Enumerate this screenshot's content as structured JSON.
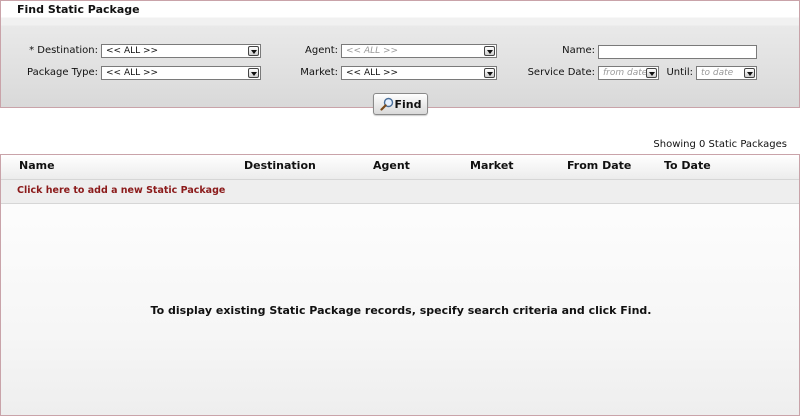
{
  "panel": {
    "title": "Find Static Package"
  },
  "form": {
    "destination": {
      "label": "* Destination:",
      "value": "<< ALL >>"
    },
    "agent": {
      "label": "Agent:",
      "placeholder": "<< ALL >>"
    },
    "name": {
      "label": "Name:",
      "value": ""
    },
    "package_type": {
      "label": "Package Type:",
      "value": "<< ALL >>"
    },
    "market": {
      "label": "Market:",
      "value": "<< ALL >>"
    },
    "service_date": {
      "label": "Service Date:",
      "placeholder": "from date"
    },
    "until": {
      "label": "Until:",
      "placeholder": "to date"
    }
  },
  "find_button": {
    "label": "Find"
  },
  "results": {
    "count_text": "Showing 0 Static Packages",
    "columns": [
      "Name",
      "Destination",
      "Agent",
      "Market",
      "From Date",
      "To Date"
    ],
    "add_link": "Click here to add a new Static Package",
    "empty_message": "To display existing Static Package records, specify search criteria and click Find."
  },
  "colors": {
    "link": "#8b1a1a",
    "border": "#c9a3a9"
  },
  "icons": {
    "find": "magnifier-icon",
    "dropdown": "chevron-down-icon"
  }
}
